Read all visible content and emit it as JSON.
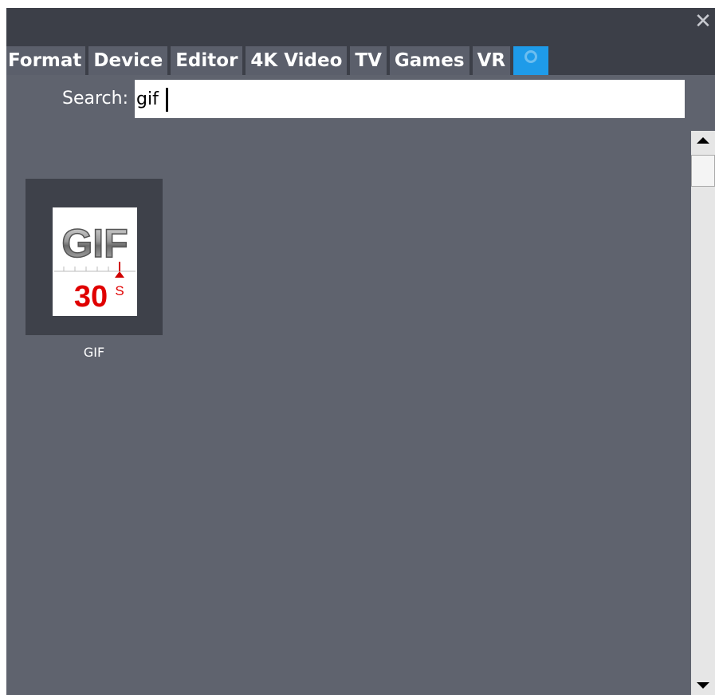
{
  "window": {
    "close_glyph": "✕"
  },
  "tabs": [
    {
      "label": "Format"
    },
    {
      "label": "Device"
    },
    {
      "label": "Editor"
    },
    {
      "label": "4K Video"
    },
    {
      "label": "TV"
    },
    {
      "label": "Games"
    },
    {
      "label": "VR"
    }
  ],
  "search_tab": {
    "icon": "search-icon",
    "active": true,
    "color": "#1e9be9"
  },
  "search": {
    "label": "Search:",
    "value": "gif"
  },
  "results": [
    {
      "label": "GIF",
      "icon": {
        "logo_text": "GIF",
        "number": "30",
        "unit": "S"
      }
    }
  ],
  "scrollbar": {
    "position": 0
  }
}
